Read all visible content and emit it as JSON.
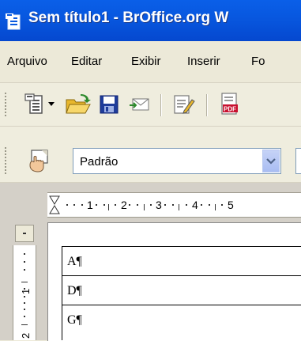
{
  "window": {
    "title": "Sem título1 - BrOffice.org W"
  },
  "menu": [
    {
      "label": "Arquivo"
    },
    {
      "label": "Editar"
    },
    {
      "label": "Exibir"
    },
    {
      "label": "Inserir"
    },
    {
      "label": "Fo"
    }
  ],
  "toolbar": {
    "icons": [
      "new-document-icon",
      "dropdown-arrow-icon",
      "open-folder-icon",
      "save-icon",
      "email-icon",
      "edit-file-icon",
      "export-pdf-icon"
    ],
    "pdf_label": "PDF"
  },
  "formatting": {
    "style_value": "Padrão"
  },
  "ruler": {
    "numbers": [
      "1",
      "2",
      "3",
      "4",
      "5"
    ]
  },
  "table": {
    "rows": [
      "A¶",
      "D¶",
      "G¶"
    ]
  },
  "colors": {
    "titlebar": "#0858e0",
    "chrome": "#ece9d8"
  }
}
